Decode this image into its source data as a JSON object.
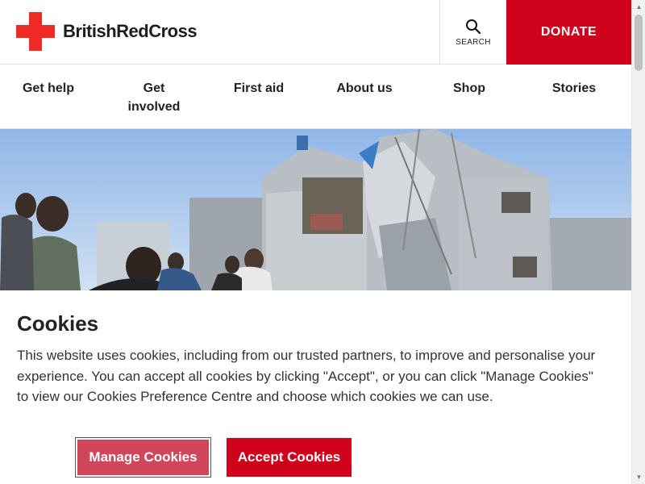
{
  "header": {
    "brand": "BritishRedCross",
    "logo_icon": "red-cross-icon",
    "search_icon": "search-icon",
    "search_label": "SEARCH",
    "donate_label": "DONATE",
    "brand_color": "#d0021b"
  },
  "nav": {
    "items": [
      {
        "label": "Get help"
      },
      {
        "label": "Get\ninvolved"
      },
      {
        "label": "First aid"
      },
      {
        "label": "About us"
      },
      {
        "label": "Shop"
      },
      {
        "label": "Stories"
      }
    ]
  },
  "cookies": {
    "title": "Cookies",
    "text": "This website uses cookies, including from our trusted partners, to improve and personalise your experience. You can accept all cookies by clicking \"Accept\", or you can click \"Manage Cookies\" to view our Cookies Preference Centre and choose which cookies we can use.",
    "manage_label": "Manage Cookies",
    "accept_label": "Accept Cookies"
  }
}
